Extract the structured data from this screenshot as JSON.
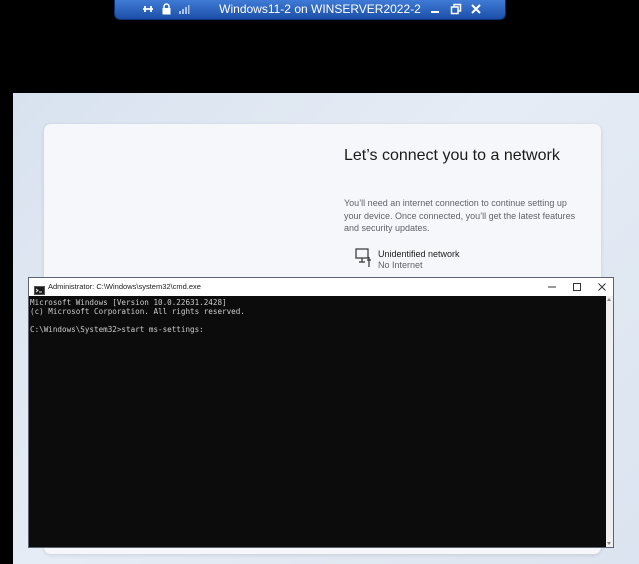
{
  "rdp_bar": {
    "title": "Windows11-2 on WINSERVER2022-2",
    "icons": [
      "pin-icon",
      "lock-icon",
      "signal-icon",
      "minimize-icon",
      "restore-icon",
      "close-icon"
    ]
  },
  "setup": {
    "heading": "Let’s connect you to a network",
    "description": "You’ll need an internet connection to continue setting up your device. Once connected, you’ll get the latest features and security updates.",
    "network": {
      "name": "Unidentified network",
      "status": "No Internet",
      "icon": "wired-network-icon"
    }
  },
  "cmd_window": {
    "title": "Administrator: C:\\Windows\\system32\\cmd.exe",
    "lines": [
      "Microsoft Windows [Version 10.0.22631.2428]",
      "(c) Microsoft Corporation. All rights reserved.",
      "",
      "C:\\Windows\\System32>start ms-settings:"
    ],
    "controls": [
      "minimize-icon",
      "maximize-icon",
      "close-icon"
    ]
  }
}
